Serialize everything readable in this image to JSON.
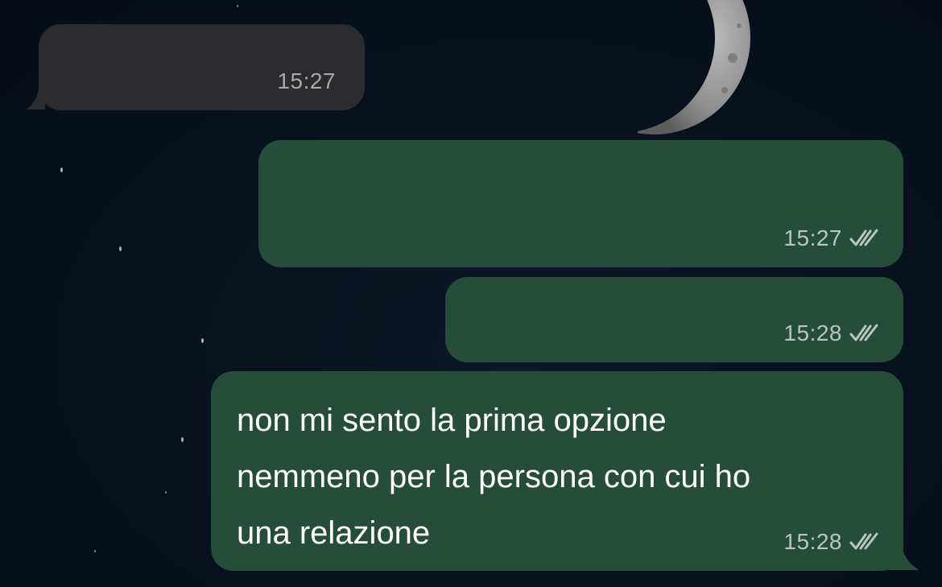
{
  "chat": {
    "messages": [
      {
        "direction": "incoming",
        "text": "",
        "time": "15:27"
      },
      {
        "direction": "outgoing",
        "text": "",
        "time": "15:27",
        "status_icon": "double-check-icon"
      },
      {
        "direction": "outgoing",
        "text": "",
        "time": "15:28",
        "status_icon": "double-check-icon"
      },
      {
        "direction": "outgoing",
        "text_lines": [
          "non mi sento la prima opzione",
          "nemmeno per la persona con cui ho",
          "una relazione"
        ],
        "time": "15:28",
        "status_icon": "double-check-icon"
      }
    ]
  },
  "colors": {
    "background": "#07111d",
    "incoming_bubble": "#2b2b2d",
    "outgoing_bubble": "#264d3a",
    "timestamp": "#b8c6bf"
  },
  "wallpaper": {
    "elements": [
      "crescent-moon",
      "stars"
    ]
  }
}
